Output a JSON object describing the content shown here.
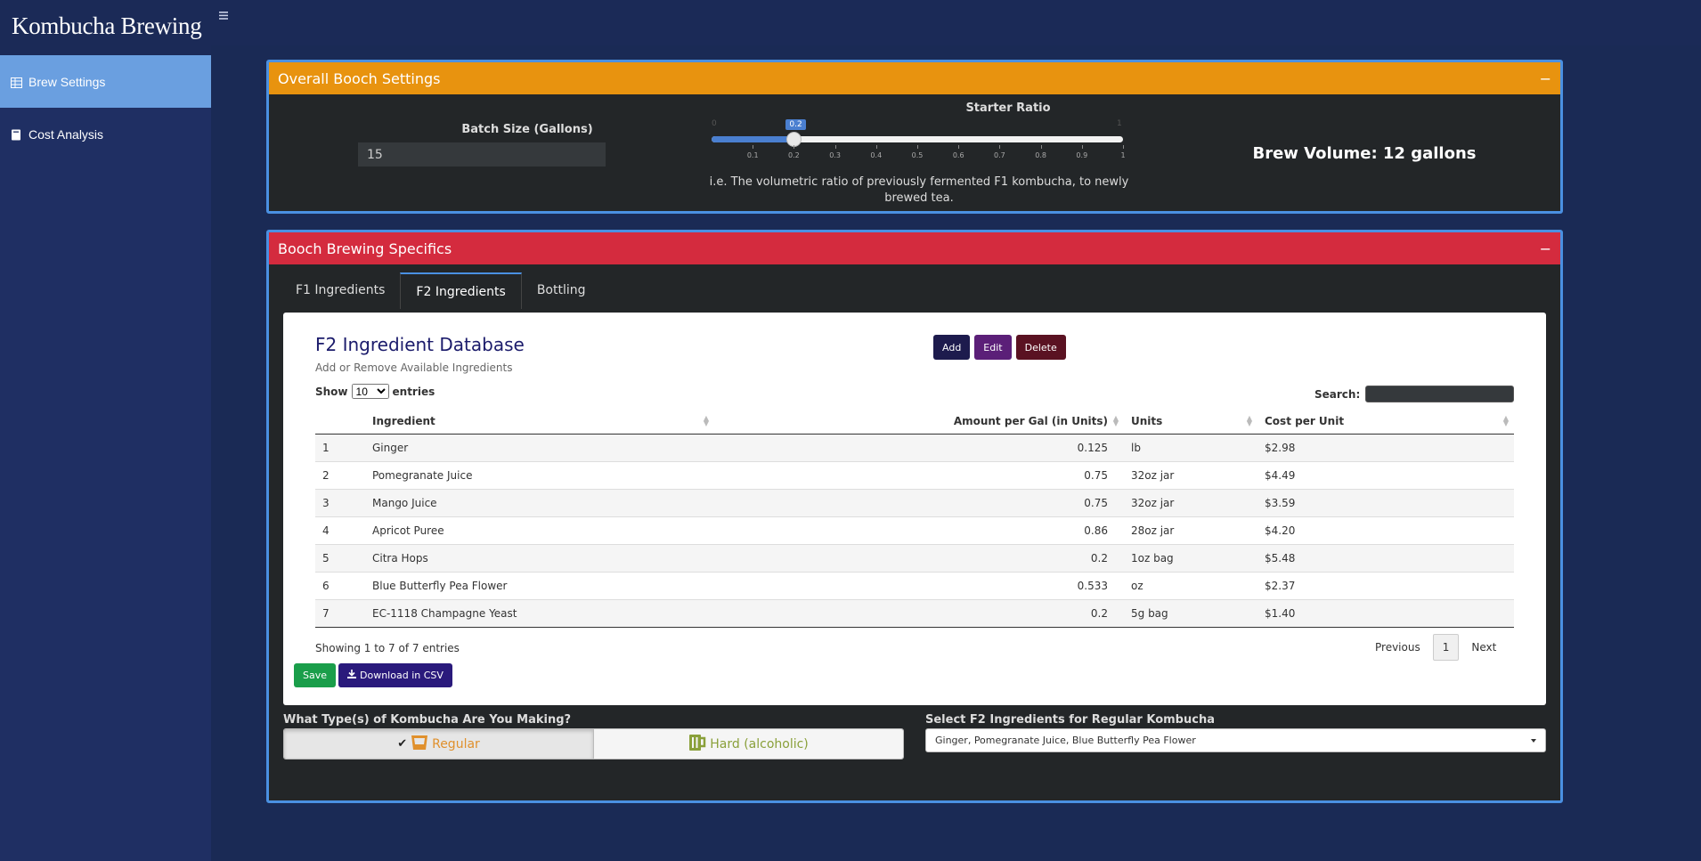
{
  "app": {
    "title": "Kombucha Brewing"
  },
  "sidebar": {
    "items": [
      {
        "label": "Brew Settings",
        "icon": "table-icon",
        "active": true
      },
      {
        "label": "Cost Analysis",
        "icon": "book-icon",
        "active": false
      }
    ]
  },
  "overall": {
    "title": "Overall Booch Settings",
    "collapse_symbol": "−",
    "batch_label": "Batch Size (Gallons)",
    "batch_value": "15",
    "starter_label": "Starter Ratio",
    "starter": {
      "min": "0",
      "max": "1",
      "value": 0.2,
      "value_label": "0.2",
      "ticks": [
        "0.1",
        "0.2",
        "0.3",
        "0.4",
        "0.5",
        "0.6",
        "0.7",
        "0.8",
        "0.9",
        "1"
      ]
    },
    "starter_help": "i.e. The volumetric ratio of previously fermented F1 kombucha, to newly brewed tea.",
    "brew_volume": "Brew Volume: 12 gallons"
  },
  "specifics": {
    "title": "Booch Brewing Specifics",
    "collapse_symbol": "−",
    "tabs": [
      {
        "label": "F1 Ingredients",
        "active": false
      },
      {
        "label": "F2 Ingredients",
        "active": true
      },
      {
        "label": "Bottling",
        "active": false
      }
    ]
  },
  "database": {
    "title": "F2 Ingredient Database",
    "subtitle": "Add or Remove Available Ingredients",
    "buttons": {
      "add": "Add",
      "edit": "Edit",
      "delete": "Delete"
    },
    "show_label": "Show",
    "show_value": "10",
    "entries_label": "entries",
    "search_label": "Search:",
    "columns": [
      "",
      "Ingredient",
      "Amount per Gal (in Units)",
      "Units",
      "Cost per Unit"
    ],
    "rows": [
      {
        "id": "1",
        "ingredient": "Ginger",
        "amount": "0.125",
        "units": "lb",
        "cost": "$2.98"
      },
      {
        "id": "2",
        "ingredient": "Pomegranate Juice",
        "amount": "0.75",
        "units": "32oz jar",
        "cost": "$4.49"
      },
      {
        "id": "3",
        "ingredient": "Mango Juice",
        "amount": "0.75",
        "units": "32oz jar",
        "cost": "$3.59"
      },
      {
        "id": "4",
        "ingredient": "Apricot Puree",
        "amount": "0.86",
        "units": "28oz jar",
        "cost": "$4.20"
      },
      {
        "id": "5",
        "ingredient": "Citra Hops",
        "amount": "0.2",
        "units": "1oz bag",
        "cost": "$5.48"
      },
      {
        "id": "6",
        "ingredient": "Blue Butterfly Pea Flower",
        "amount": "0.533",
        "units": "oz",
        "cost": "$2.37"
      },
      {
        "id": "7",
        "ingredient": "EC-1118 Champagne Yeast",
        "amount": "0.2",
        "units": "5g bag",
        "cost": "$1.40"
      }
    ],
    "info": "Showing 1 to 7 of 7 entries",
    "pager": {
      "previous": "Previous",
      "current": "1",
      "next": "Next"
    },
    "save_label": "Save",
    "csv_label": "Download in CSV"
  },
  "kombucha_type": {
    "label": "What Type(s) of Kombucha Are You Making?",
    "options": [
      {
        "label": "Regular",
        "selected": true,
        "icon": "cup-icon"
      },
      {
        "label": "Hard (alcoholic)",
        "selected": false,
        "icon": "beer-mug-icon"
      }
    ]
  },
  "f2_select": {
    "label": "Select F2 Ingredients for Regular Kombucha",
    "value": "Ginger, Pomegranate Juice, Blue Butterfly Pea Flower"
  },
  "colors": {
    "overall_header": "#e8930f",
    "specifics_header": "#d42b3e",
    "box_border": "#4a90e2",
    "sidebar_active": "#6a9fe0"
  }
}
